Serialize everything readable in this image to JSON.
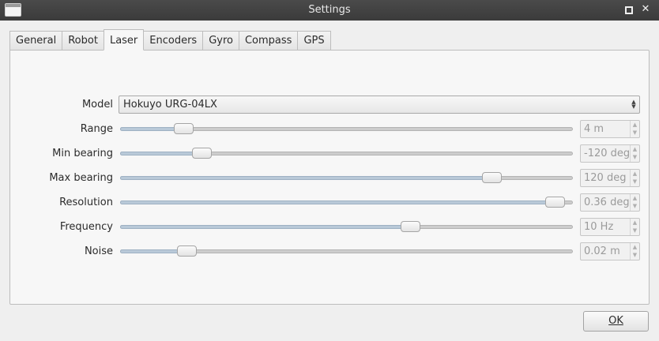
{
  "window": {
    "title": "Settings"
  },
  "tabs": [
    {
      "label": "General"
    },
    {
      "label": "Robot"
    },
    {
      "label": "Laser",
      "active": true
    },
    {
      "label": "Encoders"
    },
    {
      "label": "Gyro"
    },
    {
      "label": "Compass"
    },
    {
      "label": "GPS"
    }
  ],
  "laser": {
    "model_label": "Model",
    "model_value": "Hokuyo URG-04LX",
    "rows": [
      {
        "label": "Range",
        "value": "4 m",
        "level": 0.14
      },
      {
        "label": "Min bearing",
        "value": "-120 deg",
        "level": 0.18
      },
      {
        "label": "Max bearing",
        "value": "120 deg",
        "level": 0.82
      },
      {
        "label": "Resolution",
        "value": "0.36 deg",
        "level": 0.96
      },
      {
        "label": "Frequency",
        "value": "10 Hz",
        "level": 0.64
      },
      {
        "label": "Noise",
        "value": "0.02 m",
        "level": 0.147
      }
    ]
  },
  "buttons": {
    "ok": "OK"
  },
  "colors": {
    "titlebar": "#3f3f3f",
    "accent_fill": "#b9c9d8"
  }
}
